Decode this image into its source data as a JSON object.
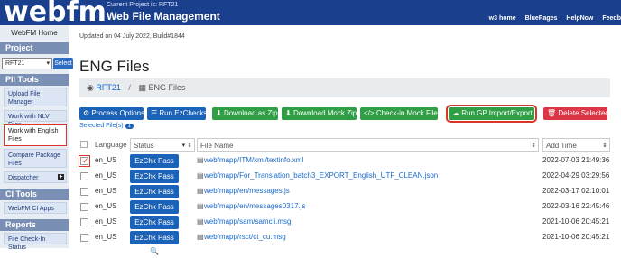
{
  "header": {
    "logo": "webfm",
    "current_project": "Current Project is: RFT21",
    "app_title": "Web File Management",
    "links": [
      "w3 home",
      "BluePages",
      "HelpNow",
      "Feedb"
    ]
  },
  "sidebar": {
    "home": "WebFM Home",
    "project_section": "Project",
    "project_value": "RFT21",
    "select_label": "Select",
    "pii_section": "PII Tools",
    "pii_items": [
      "Upload File Manager",
      "Work with NLV Files",
      "Work with English Files",
      "Compare Package Files",
      "Dispatcher"
    ],
    "ci_section": "CI Tools",
    "ci_items": [
      "WebFM CI Apps"
    ],
    "reports_section": "Reports",
    "reports_items": [
      "File Check-In Status"
    ]
  },
  "main": {
    "updated": "Updated on 04 July 2022, Build#1844",
    "title": "ENG Files",
    "breadcrumb": {
      "project": "RFT21",
      "current": "ENG Files"
    },
    "toolbar": {
      "process_options": "Process Options",
      "run_ezchecks": "Run EzChecks",
      "download_zip": "Download as Zip",
      "download_mock_zip": "Download Mock Zip",
      "checkin_mock": "Check-in Mock Files",
      "run_gp": "Run GP Import/Export",
      "delete_selected": "Delete Selected"
    },
    "selected_files_label": "Selected File(s)",
    "selected_count": "1",
    "table": {
      "headers": {
        "language": "Language",
        "status": "Status",
        "filename": "File Name",
        "addtime": "Add Time"
      },
      "rows": [
        {
          "language": "en_US",
          "status": "EzChk Pass",
          "file": "webfmapp/ITM/xml/textinfo.xml",
          "time": "2022-07-03 21:49:36"
        },
        {
          "language": "en_US",
          "status": "EzChk Pass",
          "file": "webfmapp/For_Translation_batch3_EXPORT_English_UTF_CLEAN.json",
          "time": "2022-04-29 03:29:56"
        },
        {
          "language": "en_US",
          "status": "EzChk Pass",
          "file": "webfmapp/en/messages.js",
          "time": "2022-03-17 02:10:01"
        },
        {
          "language": "en_US",
          "status": "EzChk Pass",
          "file": "webfmapp/en/messages0317.js",
          "time": "2022-03-16 22:45:46"
        },
        {
          "language": "en_US",
          "status": "EzChk Pass",
          "file": "webfmapp/sam/samcli.msg",
          "time": "2021-10-06 20:45:21"
        },
        {
          "language": "en_US",
          "status": "EzChk Pass",
          "file": "webfmapp/rsct/ct_cu.msg",
          "time": "2021-10-06 20:45:21"
        }
      ]
    }
  }
}
